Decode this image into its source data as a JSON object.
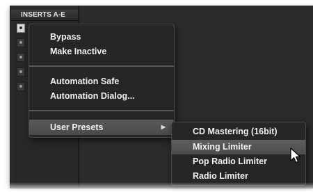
{
  "inserts_header": "INSERTS A-E",
  "context_menu": {
    "items": [
      {
        "label": "Bypass"
      },
      {
        "label": "Make Inactive"
      },
      {
        "label": "Automation Safe"
      },
      {
        "label": "Automation Dialog..."
      },
      {
        "label": "User Presets",
        "submenu_indicator": "▶"
      }
    ]
  },
  "user_presets_submenu": {
    "items": [
      {
        "label": "CD Mastering (16bit)"
      },
      {
        "label": "Mixing Limiter"
      },
      {
        "label": "Pop Radio Limiter"
      },
      {
        "label": "Radio Limiter"
      }
    ],
    "highlighted": "Mixing Limiter"
  },
  "colors": {
    "background": "#2b2b2b",
    "menu_bg": "#262626",
    "highlight": "#555555",
    "text": "#f0f0f0"
  }
}
